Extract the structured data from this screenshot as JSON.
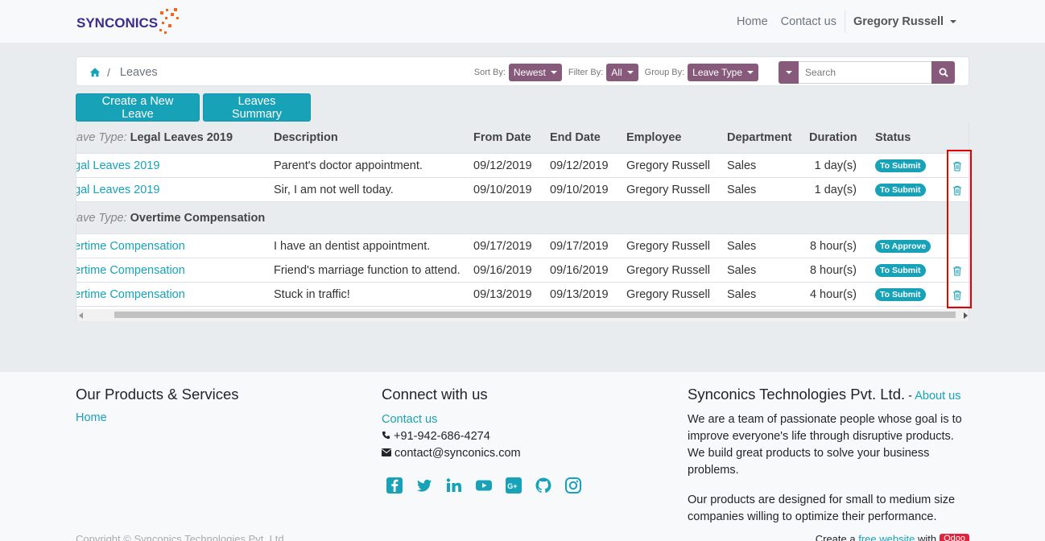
{
  "brand": {
    "name": "SYNCONICS"
  },
  "nav": {
    "home": "Home",
    "contact": "Contact us",
    "user": "Gregory Russell"
  },
  "breadcrumb": {
    "separator": "/",
    "current": "Leaves"
  },
  "controls": {
    "sort_label": "Sort By:",
    "sort_value": "Newest",
    "filter_label": "Filter By:",
    "filter_value": "All",
    "group_label": "Group By:",
    "group_value": "Leave Type",
    "search_placeholder": "Search"
  },
  "buttons": {
    "create": "Create a New Leave",
    "summary": "Leaves Summary"
  },
  "table": {
    "headers": {
      "description": "Description",
      "from": "From Date",
      "end": "End Date",
      "employee": "Employee",
      "department": "Department",
      "duration": "Duration",
      "status": "Status"
    },
    "group_prefix": "ave Type:",
    "groups": [
      {
        "name": "Legal Leaves 2019",
        "rows": [
          {
            "type": "gal Leaves 2019",
            "description": "Parent's doctor appointment.",
            "from": "09/12/2019",
            "end": "09/12/2019",
            "employee": "Gregory Russell",
            "department": "Sales",
            "duration": "1 day(s)",
            "status": "To Submit"
          },
          {
            "type": "gal Leaves 2019",
            "description": "Sir, I am not well today.",
            "from": "09/10/2019",
            "end": "09/10/2019",
            "employee": "Gregory Russell",
            "department": "Sales",
            "duration": "1 day(s)",
            "status": "To Submit"
          }
        ]
      },
      {
        "name": "Overtime Compensation",
        "rows": [
          {
            "type": "ertime Compensation",
            "description": "I have an dentist appointment.",
            "from": "09/17/2019",
            "end": "09/17/2019",
            "employee": "Gregory Russell",
            "department": "Sales",
            "duration": "8 hour(s)",
            "status": "To Approve"
          },
          {
            "type": "ertime Compensation",
            "description": "Friend's marriage function to attend.",
            "from": "09/16/2019",
            "end": "09/16/2019",
            "employee": "Gregory Russell",
            "department": "Sales",
            "duration": "8 hour(s)",
            "status": "To Submit"
          },
          {
            "type": "ertime Compensation",
            "description": "Stuck in traffic!",
            "from": "09/13/2019",
            "end": "09/13/2019",
            "employee": "Gregory Russell",
            "department": "Sales",
            "duration": "4 hour(s)",
            "status": "To Submit"
          }
        ]
      }
    ]
  },
  "footer": {
    "products_title": "Our Products & Services",
    "products_home": "Home",
    "connect_title": "Connect with us",
    "connect_contact": "Contact us",
    "phone": "+91-942-686-4274",
    "email": "contact@synconics.com",
    "company_title": "Synconics Technologies Pvt. Ltd.",
    "company_dash": " - ",
    "about": "About us",
    "para1": "We are a team of passionate people whose goal is to improve everyone's life through disruptive products. We build great products to solve your business problems.",
    "para2": "Our products are designed for small to medium size companies willing to optimize their performance.",
    "copyright": "Copyright © Synconics Technologies Pvt. Ltd.",
    "create_prefix": "Create a ",
    "create_link": "free website",
    "create_mid": " with ",
    "odoo": "Odoo"
  },
  "colors": {
    "accent": "#17a2b8",
    "odoo_purple": "#875a7b",
    "highlight": "#e00000"
  }
}
